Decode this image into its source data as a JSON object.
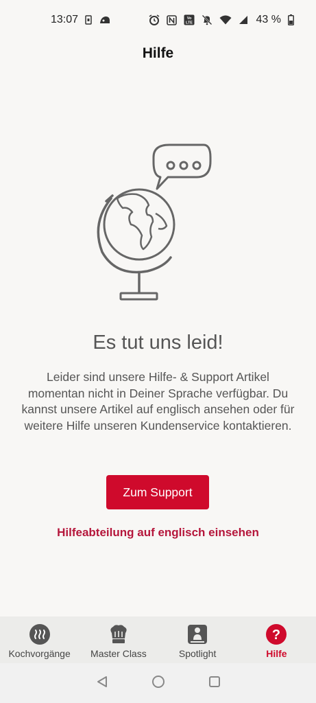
{
  "status_bar": {
    "time": "13:07",
    "battery": "43 %",
    "icons_left": [
      "sim-icon",
      "app-notification-icon"
    ],
    "icons_right": [
      "alarm-icon",
      "nfc-icon",
      "volte-icon",
      "mute-icon",
      "wifi-icon",
      "signal-icon",
      "battery-icon"
    ]
  },
  "header": {
    "title": "Hilfe"
  },
  "content": {
    "title": "Es tut uns leid!",
    "message": "Leider sind unsere Hilfe- & Support Artikel momentan nicht in Deiner Sprache verfügbar. Du kannst unsere Artikel auf englisch ansehen oder für weitere Hilfe unseren Kundenservice kontaktieren.",
    "support_button": "Zum Support",
    "english_link": "Hilfeabteilung auf englisch einsehen"
  },
  "bottom_nav": {
    "items": [
      {
        "label": "Kochvorgänge",
        "icon": "steam-pot-icon",
        "active": false
      },
      {
        "label": "Master Class",
        "icon": "chef-hat-icon",
        "active": false
      },
      {
        "label": "Spotlight",
        "icon": "spotlight-icon",
        "active": false
      },
      {
        "label": "Hilfe",
        "icon": "help-question-icon",
        "active": true
      }
    ]
  },
  "colors": {
    "accent": "#cf0a2c",
    "link": "#b5163b",
    "background": "#f8f7f5",
    "nav_background": "#ececea"
  }
}
